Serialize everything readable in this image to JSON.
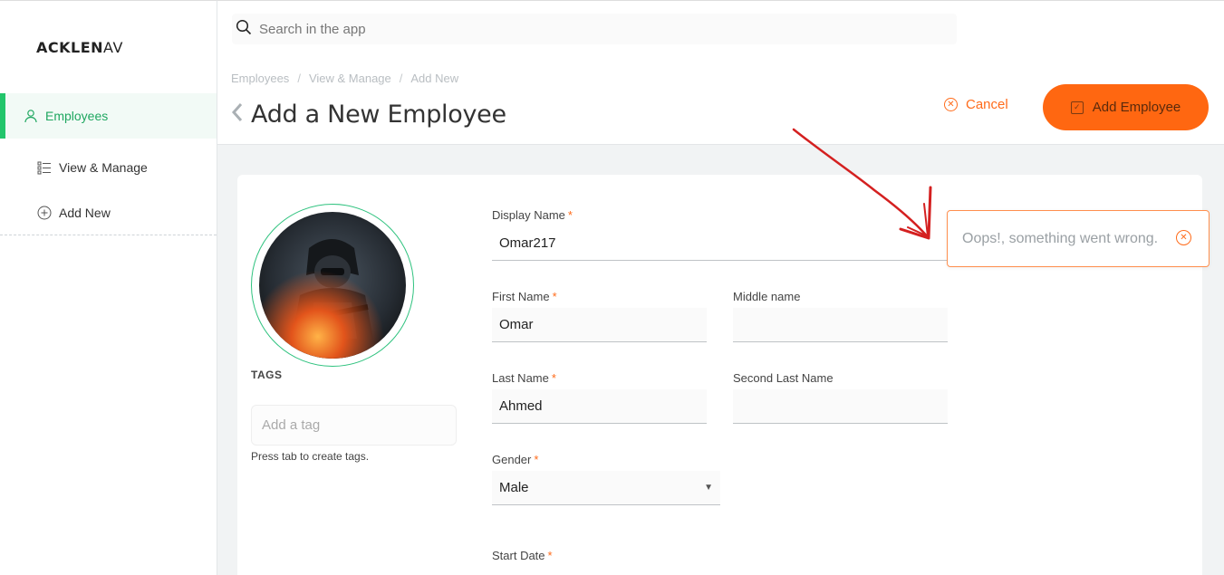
{
  "app": {
    "logo_bold": "ACKLEN",
    "logo_light": "AV"
  },
  "sidebar": {
    "items": [
      {
        "label": "Employees",
        "icon": "user-icon",
        "active": true
      },
      {
        "label": "View & Manage",
        "icon": "list-icon",
        "active": false
      },
      {
        "label": "Add New",
        "icon": "plus-circle-icon",
        "active": false
      }
    ]
  },
  "search": {
    "placeholder": "Search in the app"
  },
  "breadcrumb": {
    "items": [
      "Employees",
      "View & Manage",
      "Add New"
    ],
    "separator": "/"
  },
  "page": {
    "title": "Add a New Employee"
  },
  "actions": {
    "cancel_label": "Cancel",
    "add_label": "Add Employee"
  },
  "profile": {
    "tags_label": "TAGS",
    "tag_placeholder": "Add a tag",
    "tag_help": "Press tab to create tags."
  },
  "form": {
    "display_name": {
      "label": "Display Name",
      "value": "Omar217",
      "required": "*"
    },
    "first_name": {
      "label": "First Name",
      "value": "Omar",
      "required": "*"
    },
    "middle_name": {
      "label": "Middle name",
      "value": ""
    },
    "last_name": {
      "label": "Last Name",
      "value": "Ahmed",
      "required": "*"
    },
    "second_last_name": {
      "label": "Second Last Name",
      "value": ""
    },
    "gender": {
      "label": "Gender",
      "value": "Male",
      "required": "*"
    },
    "start_date": {
      "label": "Start Date",
      "required": "*"
    }
  },
  "toast": {
    "message": "Oops!, something went wrong."
  },
  "colors": {
    "accent": "#ff6711",
    "success": "#22c56b",
    "annotation": "#d42020"
  }
}
